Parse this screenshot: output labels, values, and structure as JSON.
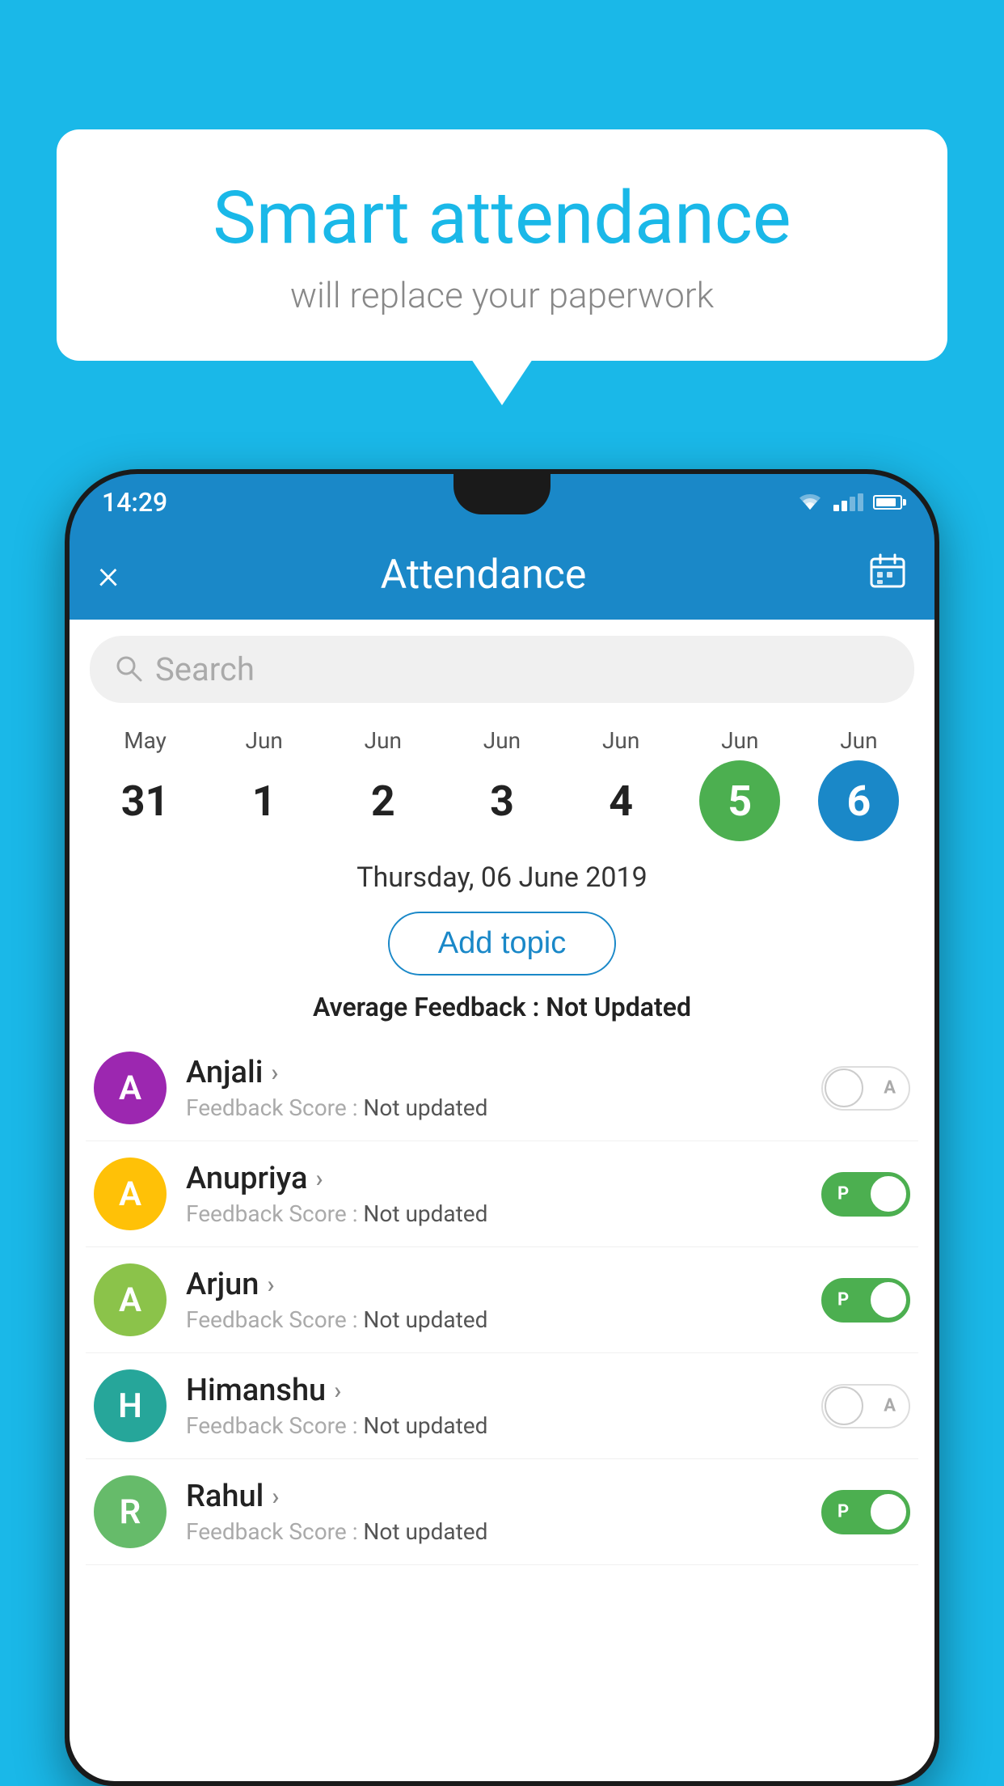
{
  "background_color": "#1ab8e8",
  "speech_bubble": {
    "title": "Smart attendance",
    "subtitle": "will replace your paperwork"
  },
  "status_bar": {
    "time": "14:29",
    "color": "#1a88c8"
  },
  "app_bar": {
    "title": "Attendance",
    "close_label": "×",
    "calendar_icon": "calendar-icon"
  },
  "search": {
    "placeholder": "Search"
  },
  "calendar": {
    "days": [
      {
        "month": "May",
        "date": "31",
        "state": "normal"
      },
      {
        "month": "Jun",
        "date": "1",
        "state": "normal"
      },
      {
        "month": "Jun",
        "date": "2",
        "state": "normal"
      },
      {
        "month": "Jun",
        "date": "3",
        "state": "normal"
      },
      {
        "month": "Jun",
        "date": "4",
        "state": "normal"
      },
      {
        "month": "Jun",
        "date": "5",
        "state": "today"
      },
      {
        "month": "Jun",
        "date": "6",
        "state": "selected"
      }
    ]
  },
  "selected_date": "Thursday, 06 June 2019",
  "add_topic_label": "Add topic",
  "avg_feedback_label": "Average Feedback :",
  "avg_feedback_value": "Not Updated",
  "students": [
    {
      "name": "Anjali",
      "avatar_letter": "A",
      "avatar_color": "purple",
      "feedback_label": "Feedback Score :",
      "feedback_value": "Not updated",
      "toggle_on": false,
      "toggle_letter": "A"
    },
    {
      "name": "Anupriya",
      "avatar_letter": "A",
      "avatar_color": "yellow",
      "feedback_label": "Feedback Score :",
      "feedback_value": "Not updated",
      "toggle_on": true,
      "toggle_letter": "P"
    },
    {
      "name": "Arjun",
      "avatar_letter": "A",
      "avatar_color": "green-light",
      "feedback_label": "Feedback Score :",
      "feedback_value": "Not updated",
      "toggle_on": true,
      "toggle_letter": "P"
    },
    {
      "name": "Himanshu",
      "avatar_letter": "H",
      "avatar_color": "teal",
      "feedback_label": "Feedback Score :",
      "feedback_value": "Not updated",
      "toggle_on": false,
      "toggle_letter": "A"
    },
    {
      "name": "Rahul",
      "avatar_letter": "R",
      "avatar_color": "green2",
      "feedback_label": "Feedback Score :",
      "feedback_value": "Not updated",
      "toggle_on": true,
      "toggle_letter": "P"
    }
  ]
}
